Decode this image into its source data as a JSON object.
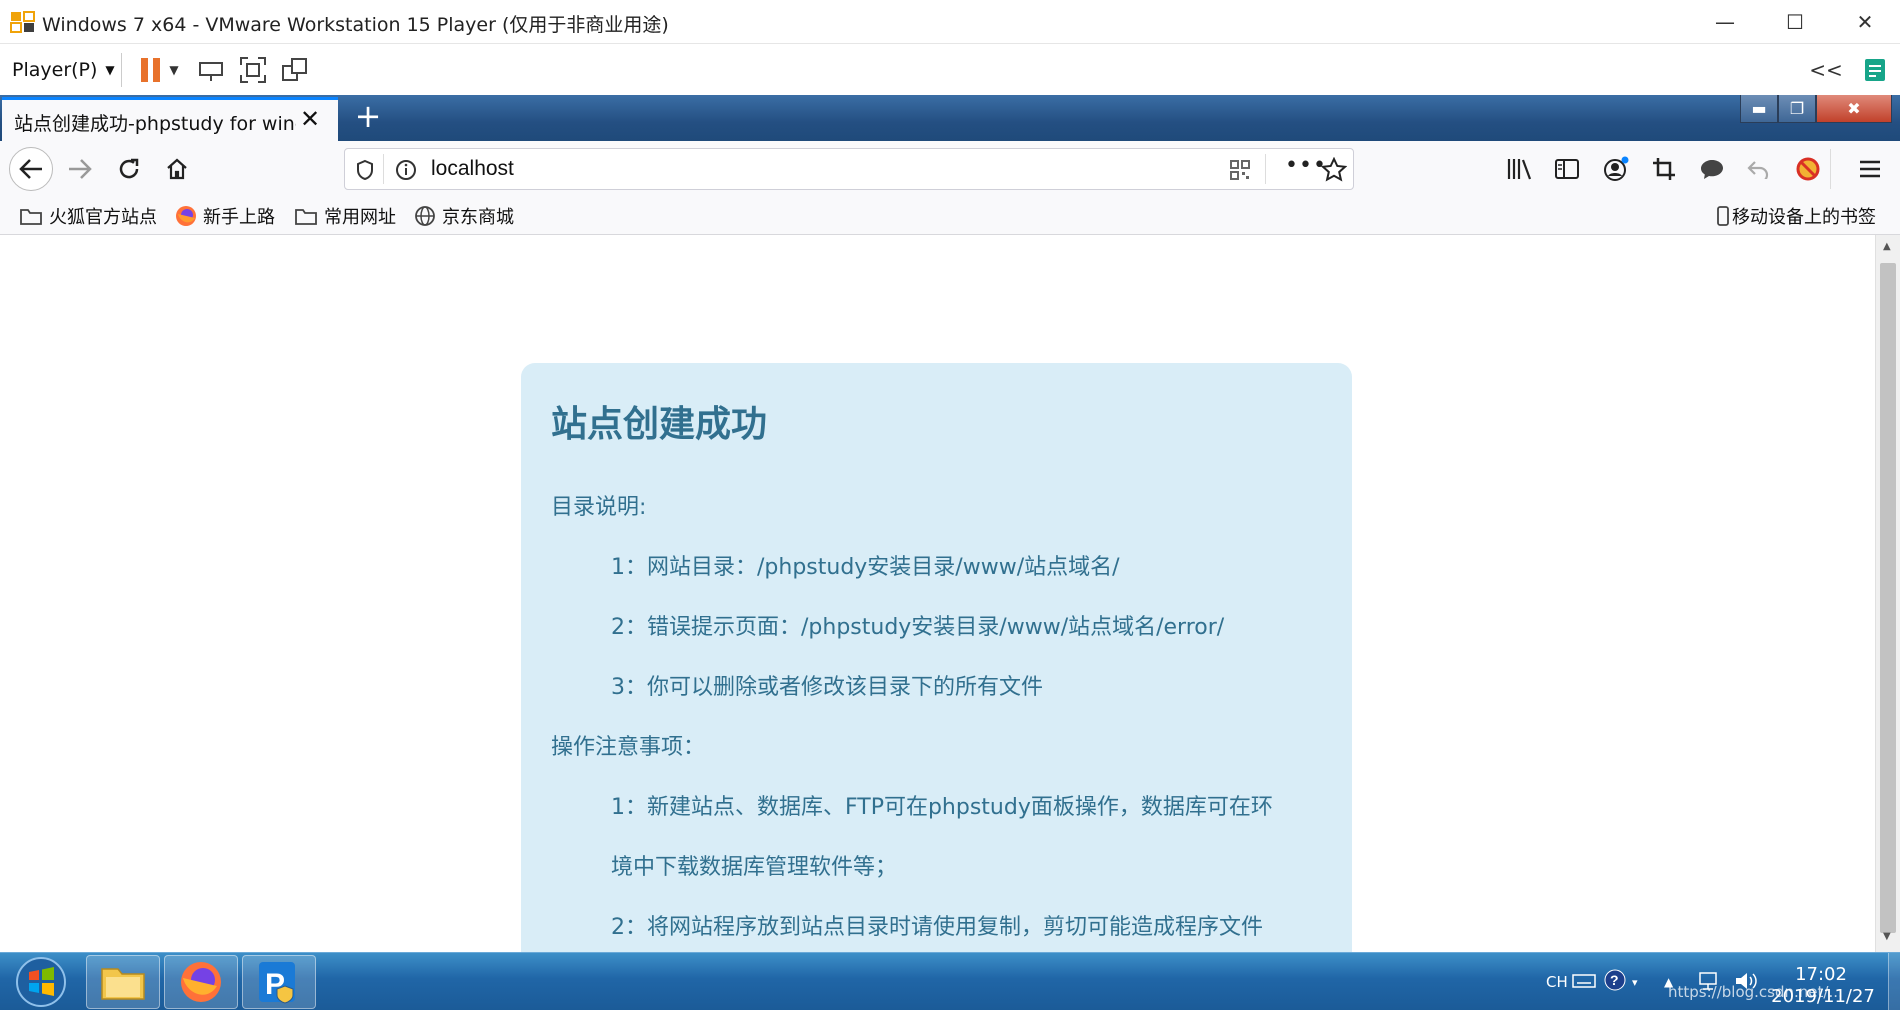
{
  "vmware": {
    "title": "Windows 7 x64 - VMware Workstation 15 Player (仅用于非商业用途)",
    "player_menu": "Player(P)",
    "collapse_label": "<<"
  },
  "firefox": {
    "tab_title": "站点创建成功-phpstudy for windows",
    "url": "localhost",
    "bookmarks": [
      "火狐官方站点",
      "新手上路",
      "常用网址",
      "京东商城"
    ],
    "mobile_bookmarks": "移动设备上的书签"
  },
  "page": {
    "heading": "站点创建成功",
    "section1_title": "目录说明:",
    "section1_items": [
      "1：网站目录：/phpstudy安装目录/www/站点域名/",
      "2：错误提示页面：/phpstudy安装目录/www/站点域名/error/",
      "3：你可以删除或者修改该目录下的所有文件"
    ],
    "section2_title": "操作注意事项：",
    "section2_items": [
      "1：新建站点、数据库、FTP可在phpstudy面板操作，数据库可在环",
      "境中下载数据库管理软件等；",
      "2：将网站程序放到站点目录时请使用复制，剪切可能造成程序文件"
    ]
  },
  "taskbar": {
    "lang": "CH",
    "time": "17:02",
    "date": "2019/11/27",
    "watermark": "https://blog.csdn.net/..."
  },
  "colors": {
    "accent": "#0a84ff",
    "card_bg": "#d9edf7",
    "card_text": "#31708f",
    "pause": "#e8722c"
  }
}
